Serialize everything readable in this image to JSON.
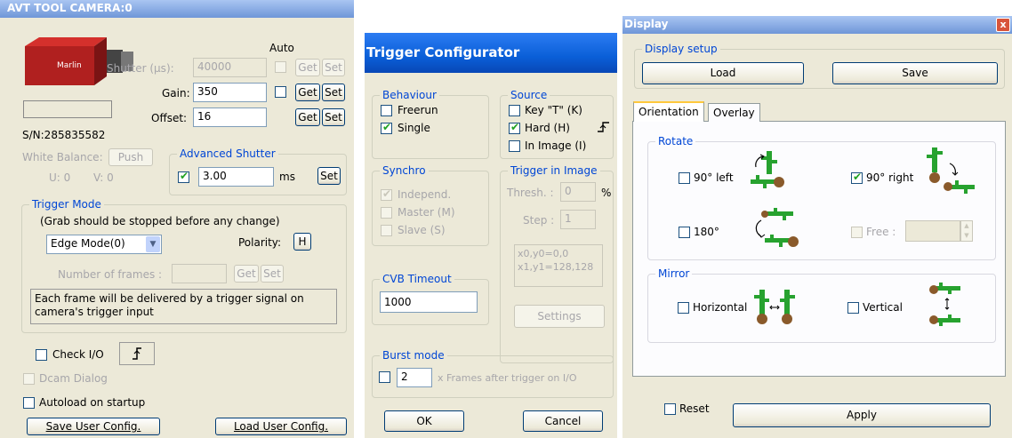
{
  "camera_window": {
    "title": "AVT TOOL CAMERA:0",
    "auto_label": "Auto",
    "shutter_label": "Shutter (µs):",
    "shutter_value": "40000",
    "gain_label": "Gain:",
    "gain_value": "350",
    "offset_label": "Offset:",
    "offset_value": "16",
    "get_label": "Get",
    "set_label": "Set",
    "serial": "S/N:285835582",
    "white_balance_label": "White Balance:",
    "push_label": "Push",
    "u_label": "U:",
    "u_value": "0",
    "v_label": "V:",
    "v_value": "0",
    "advanced_shutter_title": "Advanced Shutter",
    "adv_shutter_value": "3.00",
    "adv_shutter_unit": "ms",
    "trigger_mode_title": "Trigger Mode",
    "trigger_note": "(Grab should be stopped before any change)",
    "trigger_mode_value": "Edge Mode(0)",
    "polarity_label": "Polarity:",
    "polarity_value": "H",
    "frames_label": "Number of frames :",
    "trigger_description": "Each frame will be delivered by a trigger signal on camera's trigger input",
    "check_io_label": "Check I/O",
    "dcam_dialog_label": "Dcam Dialog",
    "autoload_label": "Autoload on startup",
    "save_user_config": "Save User Config.",
    "load_user_config": "Load User Config."
  },
  "trigger_window": {
    "title": "Trigger Configurator",
    "behaviour_title": "Behaviour",
    "freerun_label": "Freerun",
    "single_label": "Single",
    "source_title": "Source",
    "key_label": "Key \"T\" (K)",
    "hard_label": "Hard (H)",
    "in_image_label": "In Image (I)",
    "synchro_title": "Synchro",
    "independ_label": "Independ.",
    "master_label": "Master (M)",
    "slave_label": "Slave (S)",
    "trigger_in_image_title": "Trigger in Image",
    "thresh_label": "Thresh. :",
    "thresh_value": "0",
    "percent": "%",
    "step_label": "Step :",
    "step_value": "1",
    "coords_line1": "x0,y0=0,0",
    "coords_line2": "x1,y1=128,128",
    "cvb_timeout_title": "CVB Timeout",
    "cvb_timeout_value": "1000",
    "settings_label": "Settings",
    "burst_title": "Burst mode",
    "burst_value": "2",
    "burst_text": "x Frames after trigger on I/O",
    "ok_label": "OK",
    "cancel_label": "Cancel"
  },
  "display_window": {
    "title": "Display",
    "close_label": "x",
    "display_setup_title": "Display setup",
    "load_label": "Load",
    "save_label": "Save",
    "tabs": [
      "Orientation",
      "Overlay"
    ],
    "rotate_title": "Rotate",
    "left90_label": "90° left",
    "right90_label": "90° right",
    "rot180_label": "180°",
    "free_label": "Free :",
    "mirror_title": "Mirror",
    "horizontal_label": "Horizontal",
    "vertical_label": "Vertical",
    "reset_label": "Reset",
    "apply_label": "Apply"
  },
  "colors": {
    "title_blue": "#0a5fd8",
    "group_title": "#0046d5",
    "check_green": "#21a121",
    "cactus_green": "#27a22f",
    "camera_red": "#b0201f"
  },
  "icons": [
    "camera-image",
    "edge-polarity-icon",
    "cactus-icon",
    "rotate-arrow-icon",
    "mirror-arrow-icon"
  ]
}
